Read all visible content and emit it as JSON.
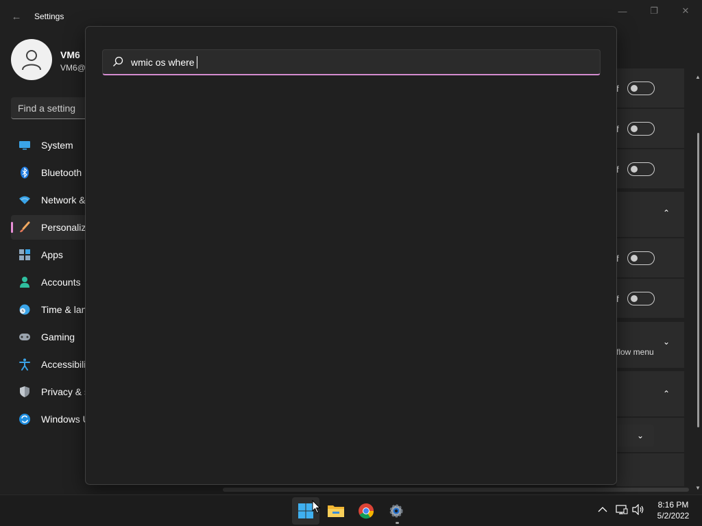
{
  "window": {
    "title": "Settings",
    "back_glyph": "←",
    "controls": {
      "minimize": "—",
      "maximize": "❐",
      "close": "✕"
    }
  },
  "user": {
    "name": "VM6",
    "email": "VM6@"
  },
  "find_setting": {
    "placeholder": "Find a setting"
  },
  "nav": {
    "items": [
      {
        "label": "System",
        "icon": "monitor-icon"
      },
      {
        "label": "Bluetooth",
        "icon": "bluetooth-icon"
      },
      {
        "label": "Network &",
        "icon": "wifi-icon"
      },
      {
        "label": "Personaliz",
        "icon": "brush-icon",
        "active": true
      },
      {
        "label": "Apps",
        "icon": "apps-icon"
      },
      {
        "label": "Accounts",
        "icon": "person-icon"
      },
      {
        "label": "Time & lan",
        "icon": "clock-globe-icon"
      },
      {
        "label": "Gaming",
        "icon": "gamepad-icon"
      },
      {
        "label": "Accessibilit",
        "icon": "accessibility-icon"
      },
      {
        "label": "Privacy & s",
        "icon": "shield-icon"
      },
      {
        "label": "Windows U",
        "icon": "update-icon"
      }
    ]
  },
  "content": {
    "rows": [
      {
        "partial": "f",
        "control": "toggle-off"
      },
      {
        "partial": "f",
        "control": "toggle-off"
      },
      {
        "partial": "f",
        "control": "toggle-off"
      },
      {
        "partial": "",
        "control": "chevron-up"
      },
      {
        "partial": "f",
        "control": "toggle-off"
      },
      {
        "partial": "f",
        "control": "toggle-off"
      },
      {
        "partial": "flow menu",
        "control": "chevron-down"
      },
      {
        "partial": "",
        "control": "chevron-up"
      }
    ],
    "chevron_up": "⌃",
    "chevron_down": "⌄"
  },
  "search": {
    "query": "wmic os where"
  },
  "taskbar": {
    "apps": [
      "start-icon",
      "file-explorer-icon",
      "chrome-icon",
      "settings-icon"
    ],
    "tray": {
      "overflow": "^",
      "network": "network-icon",
      "volume": "volume-icon"
    },
    "time": "8:16 PM",
    "date": "5/2/2022"
  },
  "colors": {
    "background": "#202020",
    "accent": "#e88fd7",
    "panel": "#2b2b2b"
  }
}
